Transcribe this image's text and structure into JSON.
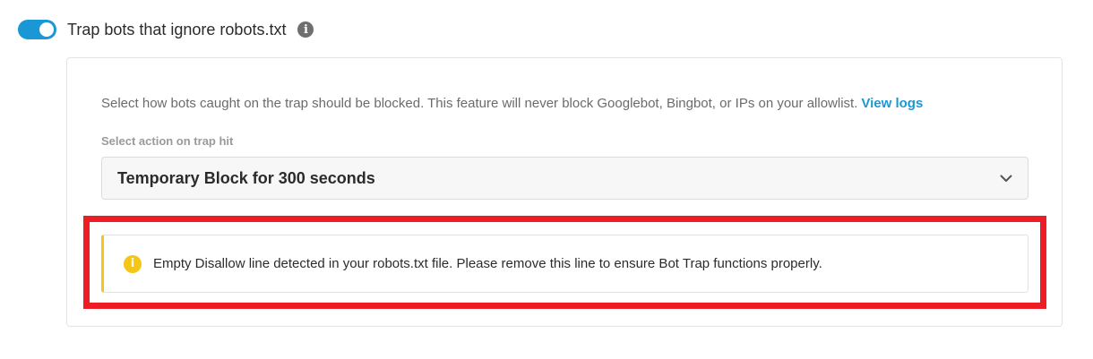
{
  "bot_trap": {
    "toggle_enabled": true,
    "title": "Trap bots that ignore robots.txt",
    "info_icon": "info-icon",
    "description": "Select how bots caught on the trap should be blocked. This feature will never block Googlebot, Bingbot, or IPs on your allowlist.",
    "view_logs_label": "View logs",
    "action_label": "Select action on trap hit",
    "action_selected": "Temporary Block for 300 seconds",
    "notice": {
      "icon": "warning-icon",
      "text": "Empty Disallow line detected in your robots.txt file. Please remove this line to ensure Bot Trap functions properly."
    }
  },
  "colors": {
    "accent": "#1a98d5",
    "warning": "#f5c518",
    "highlight_border": "#ee1c24"
  }
}
